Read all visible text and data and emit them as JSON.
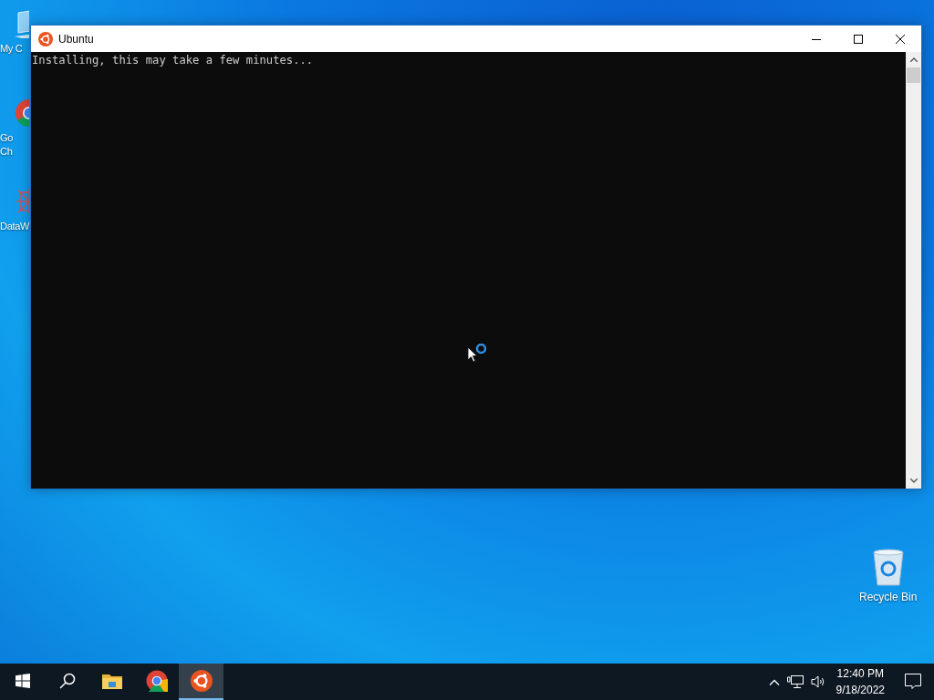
{
  "desktop_icons": [
    {
      "kind": "pc",
      "label_lines": [
        "My C"
      ]
    },
    {
      "kind": "browser",
      "label_lines": [
        "Go",
        "Ch"
      ]
    },
    {
      "kind": "app",
      "label_lines": [
        "DataW"
      ]
    },
    {
      "kind": "recycle",
      "label_lines": [
        "Recycle Bin"
      ]
    }
  ],
  "window": {
    "title": "Ubuntu",
    "console_lines": [
      "Installing, this may take a few minutes..."
    ]
  },
  "taskbar": {
    "items": [
      {
        "kind": "start",
        "selected": false
      },
      {
        "kind": "search",
        "selected": false
      },
      {
        "kind": "explorer",
        "selected": false
      },
      {
        "kind": "browser",
        "selected": false
      },
      {
        "kind": "ubuntu",
        "selected": true
      }
    ],
    "time": "12:40 PM",
    "date": "9/18/2022"
  }
}
